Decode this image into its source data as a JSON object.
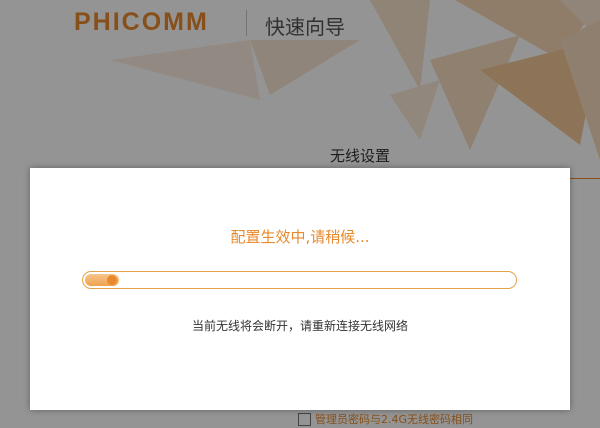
{
  "header": {
    "logo": "PHICOMM",
    "title": "快速向导"
  },
  "section": {
    "title": "无线设置"
  },
  "bottom_option": {
    "label": "管理员密码与2.4G无线密码相同",
    "checked": false
  },
  "dialog": {
    "status": "配置生效中,请稍候...",
    "progress": 0.08,
    "note": "当前无线将会断开，请重新连接无线网络"
  },
  "colors": {
    "accent": "#e8892c",
    "overlay": "rgba(0,0,0,0.42)"
  }
}
